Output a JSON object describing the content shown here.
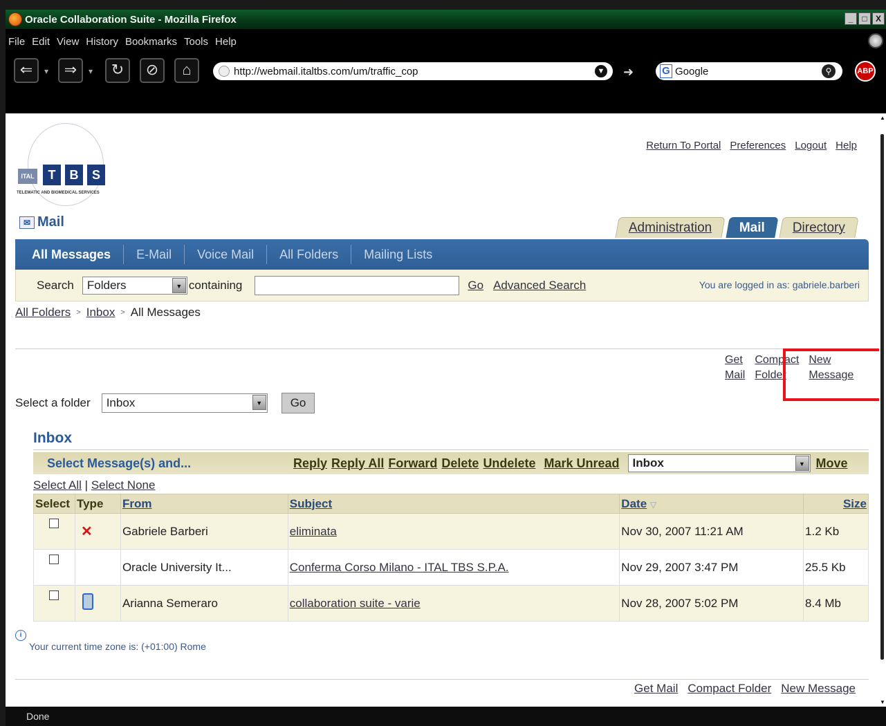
{
  "window": {
    "title": "Oracle Collaboration Suite - Mozilla Firefox",
    "controls": [
      "_",
      "□",
      "X"
    ]
  },
  "menu": [
    "File",
    "Edit",
    "View",
    "History",
    "Bookmarks",
    "Tools",
    "Help"
  ],
  "toolbar": {
    "url": "http://webmail.italtbs.com/um/traffic_cop",
    "search_engine": "Google",
    "adblock": "ABP"
  },
  "logo": {
    "prefix": "ITAL",
    "letters": [
      "T",
      "B",
      "S"
    ],
    "tagline": "TELEMATIC AND BIOMEDICAL SERVICES"
  },
  "header": {
    "links": [
      "Return To Portal",
      "Preferences",
      "Logout",
      "Help"
    ],
    "app_title": "Mail",
    "tabs": [
      {
        "label": "Administration",
        "active": false
      },
      {
        "label": "Mail",
        "active": true
      },
      {
        "label": "Directory",
        "active": false
      }
    ]
  },
  "subnav": [
    "All Messages",
    "E-Mail",
    "Voice Mail",
    "All Folders",
    "Mailing Lists"
  ],
  "search": {
    "label": "Search",
    "scope": "Folders",
    "containing": "containing",
    "value": "",
    "go": "Go",
    "advanced": "Advanced Search",
    "logged_in_label": "You are logged in as:",
    "user": "gabriele.barberi"
  },
  "breadcrumb": [
    "All Folders",
    "Inbox",
    "All Messages"
  ],
  "folder_actions": {
    "get": [
      "Get",
      "Mail"
    ],
    "compact": [
      "Compact",
      "Folder"
    ],
    "new": [
      "New",
      "Message"
    ]
  },
  "select_folder": {
    "label": "Select a folder",
    "value": "Inbox",
    "go": "Go"
  },
  "inbox_title": "Inbox",
  "action_bar": {
    "label": "Select Message(s) and...",
    "actions": [
      "Reply",
      "Reply All",
      "Forward",
      "Delete",
      "Undelete",
      "Mark Unread"
    ],
    "target_folder": "Inbox",
    "move": "Move"
  },
  "select_links": {
    "all": "Select All",
    "sep": "|",
    "none": "Select None"
  },
  "table": {
    "headers": [
      "Select",
      "Type",
      "From",
      "Subject",
      "Date",
      "Size"
    ],
    "rows": [
      {
        "type": "deleted",
        "from": "Gabriele Barberi",
        "subject": "eliminata",
        "date": "Nov 30, 2007 11:21 AM",
        "size": "1.2 Kb"
      },
      {
        "type": "",
        "from": "Oracle University It...",
        "subject": "Conferma Corso Milano - ITAL TBS S.P.A.",
        "date": "Nov 29, 2007 3:47 PM",
        "size": "25.5 Kb"
      },
      {
        "type": "attachment",
        "from": "Arianna Semeraro",
        "subject": "collaboration suite - varie",
        "date": "Nov 28, 2007 5:02 PM",
        "size": "8.4 Mb"
      }
    ]
  },
  "timezone": "Your current time zone is:  (+01:00) Rome",
  "bottom_links": [
    "Get Mail",
    "Compact Folder",
    "New Message"
  ],
  "status": "Done",
  "colors": {
    "brand_blue": "#336699",
    "tab_beige": "#e3dfbf",
    "highlight_red": "#e8141c",
    "title_green": "#063818"
  }
}
